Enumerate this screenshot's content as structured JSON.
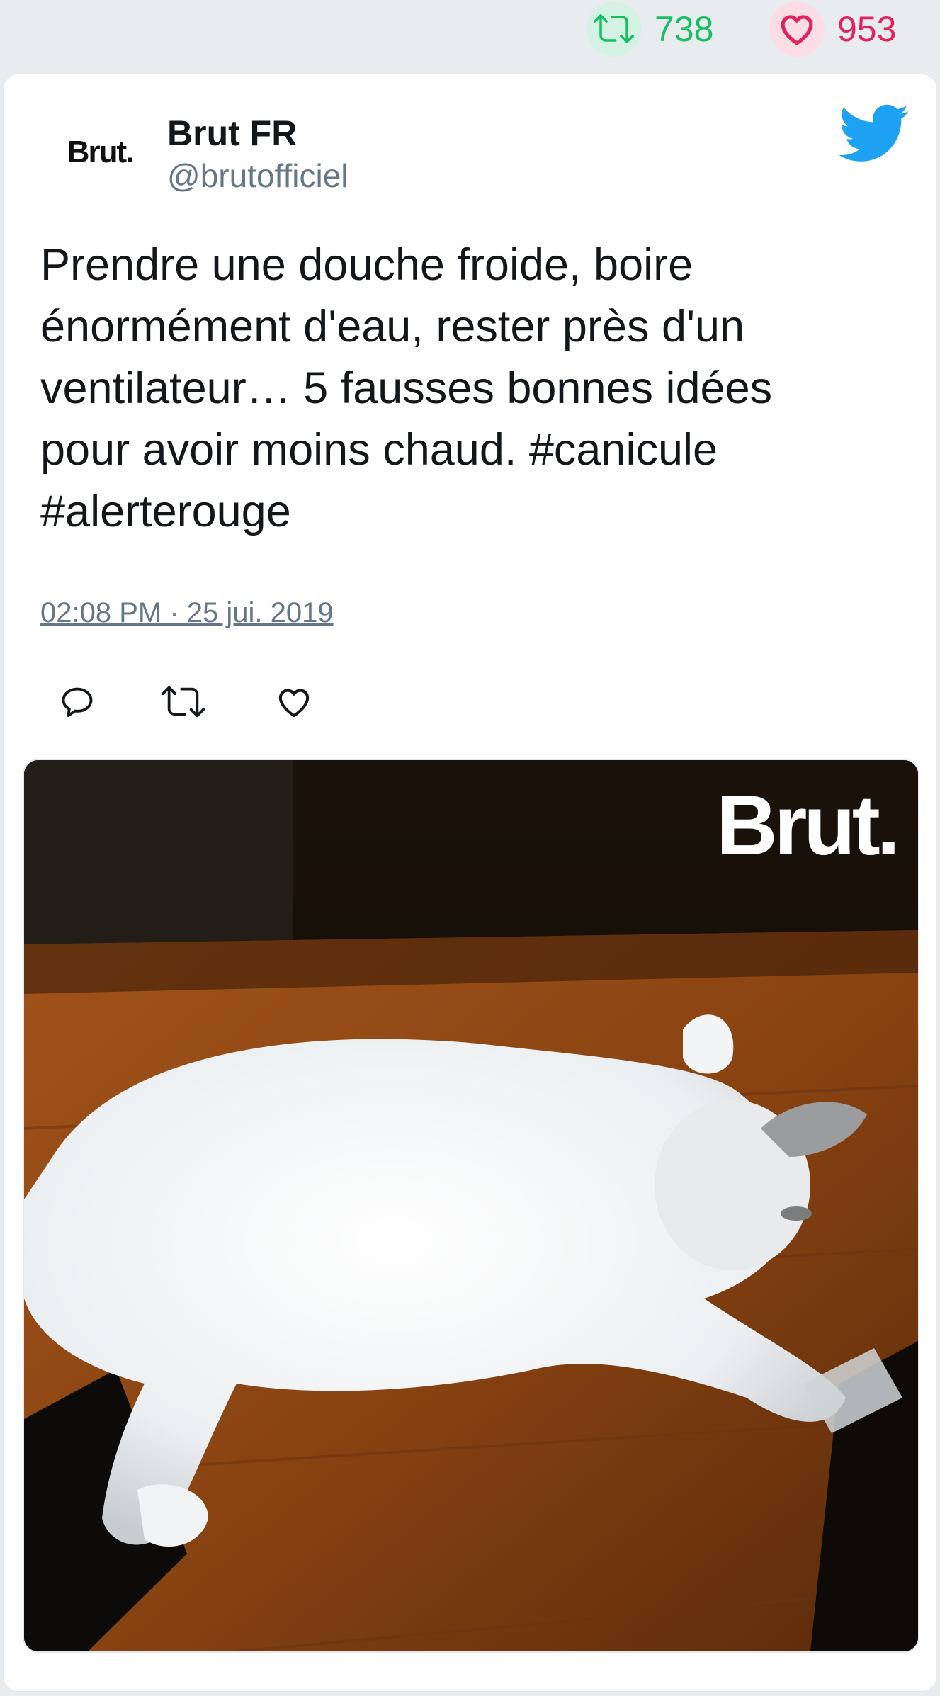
{
  "stats": {
    "retweets": "738",
    "likes": "953",
    "retweet_icon": "retweet-icon",
    "like_icon": "heart-icon"
  },
  "tweet": {
    "avatar_text": "Brut.",
    "author_name": "Brut FR",
    "author_handle": "@brutofficiel",
    "text": "Prendre une douche froide, boire\nénormément d'eau, rester près d'un\nventilateur… 5 fausses bonnes idées\npour avoir moins chaud. #canicule\n#alerterouge",
    "timestamp": "02:08 PM · 25 jui. 2019",
    "actions": [
      "reply-icon",
      "retweet-icon",
      "heart-icon"
    ]
  },
  "media": {
    "watermark": "Brut.",
    "subject": "white cat lying on a wooden floor"
  },
  "colors": {
    "twitter_blue": "#1da1f2",
    "retweet_green": "#17bf63",
    "like_red": "#e0245e",
    "text": "#14171a",
    "muted": "#657786",
    "background": "#e9ecef"
  }
}
